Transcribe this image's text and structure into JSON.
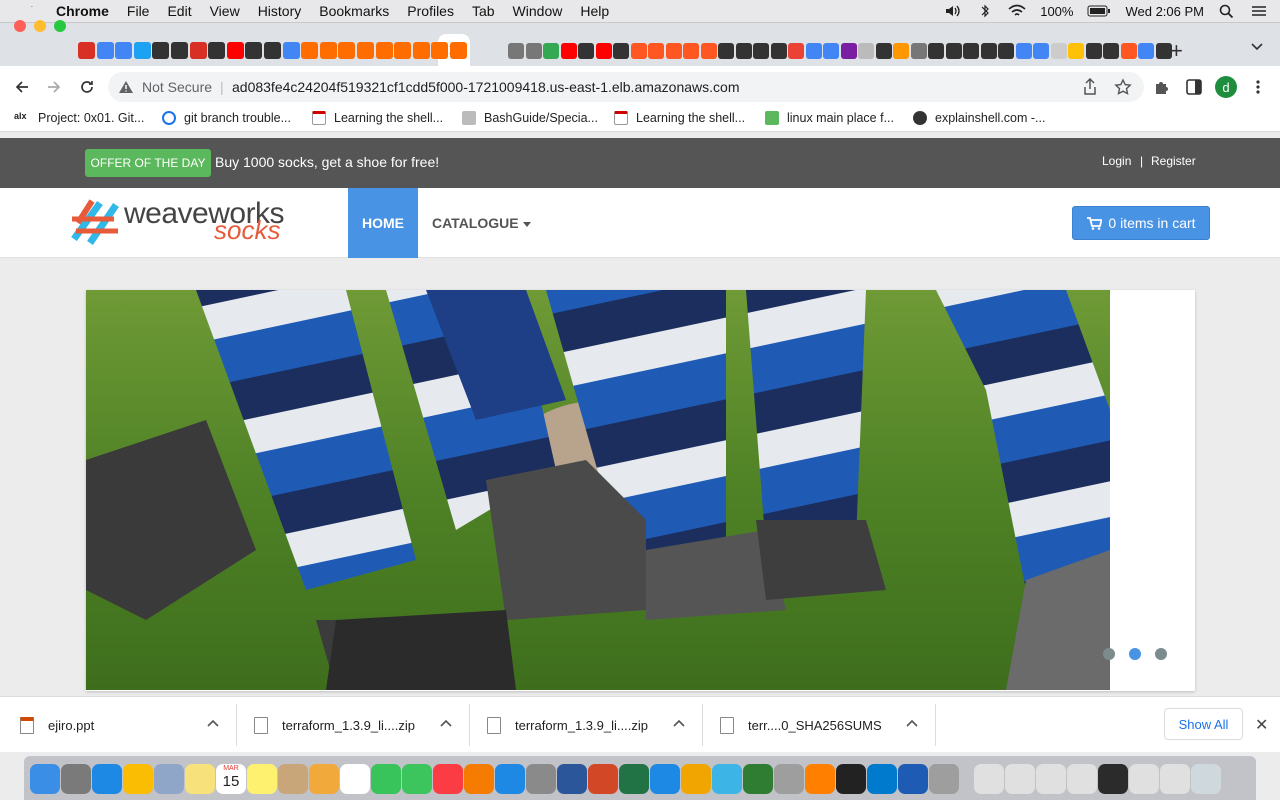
{
  "menubar": {
    "app": "Chrome",
    "items": [
      "File",
      "Edit",
      "View",
      "History",
      "Bookmarks",
      "Profiles",
      "Tab",
      "Window",
      "Help"
    ],
    "battery": "100%",
    "clock": "Wed 2:06 PM"
  },
  "browser": {
    "url_security": "Not Secure",
    "url": "ad083fe4c24204f519321cf1cdd5f000-1721009418.us-east-1.elb.amazonaws.com",
    "profile_initial": "d",
    "bookmarks": [
      {
        "label": "Project: 0x01. Git..."
      },
      {
        "label": "git branch trouble..."
      },
      {
        "label": "Learning the shell..."
      },
      {
        "label": "BashGuide/Specia..."
      },
      {
        "label": "Learning the shell..."
      },
      {
        "label": "linux main place f..."
      },
      {
        "label": "explainshell.com -..."
      }
    ]
  },
  "page": {
    "offer_badge": "OFFER OF THE DAY",
    "offer_text": "Buy 1000 socks, get a shoe for free!",
    "login": "Login",
    "separator": "|",
    "register": "Register",
    "logo_primary": "weaveworks",
    "logo_secondary": "socks",
    "nav_home": "HOME",
    "nav_catalogue": "CATALOGUE",
    "cart_label": "0 items in cart",
    "carousel": {
      "total_slides": 3,
      "active_index": 1
    }
  },
  "downloads": {
    "items": [
      {
        "name": "ejiro.ppt"
      },
      {
        "name": "terraform_1.3.9_li....zip"
      },
      {
        "name": "terraform_1.3.9_li....zip"
      },
      {
        "name": "terr....0_SHA256SUMS"
      }
    ],
    "show_all": "Show All"
  },
  "dock": {
    "calendar_month": "MAR",
    "calendar_day": "15"
  },
  "colors": {
    "offer_green": "#5cb85c",
    "brand_blue": "#4993e4",
    "topbar_gray": "#555555"
  }
}
